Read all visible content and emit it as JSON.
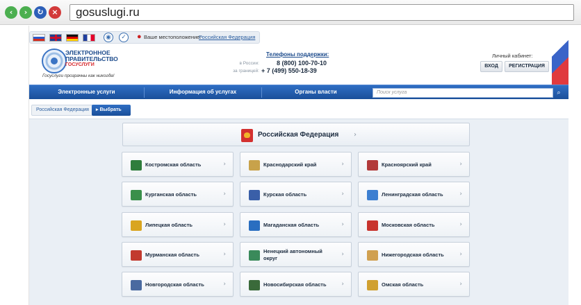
{
  "browser": {
    "url": "gosuslugi.ru",
    "buttons": [
      "back",
      "forward",
      "reload",
      "stop"
    ]
  },
  "topbar": {
    "languages": [
      "Русский",
      "English",
      "Deutsch",
      "Français"
    ],
    "location_label": "Ваше местоположение:",
    "location_value": "Российская Федерация"
  },
  "header": {
    "logo_line1": "ЭЛЕКТРОННОЕ",
    "logo_line2": "ПРАВИТЕЛЬСТВО",
    "logo_line3": "ГОСУСЛУГИ",
    "slogan": "Госуслуги прозрачны как никогда!",
    "support_title": "Телефоны поддержки:",
    "phone_ru_label": "в России:",
    "phone_ru": "8 (800) 100-70-10",
    "phone_abroad_label": "за границей:",
    "phone_abroad": "+ 7 (499) 550-18-39",
    "cabinet_title": "Личный кабинет:",
    "login": "ВХОД",
    "register": "РЕГИСТРАЦИЯ"
  },
  "navbar": {
    "items": [
      "Электронные услуги",
      "Информация об услугах",
      "Органы власти"
    ],
    "search_placeholder": "Поиск услуга"
  },
  "breadcrumb": {
    "current": "Российская Федерация",
    "select": "Выбрать"
  },
  "federation": {
    "name": "Российская Федерация"
  },
  "regions": [
    {
      "name": "Костромская область",
      "color": "#2f7d3c"
    },
    {
      "name": "Краснодарский край",
      "color": "#c8a24a"
    },
    {
      "name": "Красноярский край",
      "color": "#b23a3a"
    },
    {
      "name": "Курганская область",
      "color": "#3a8f4a"
    },
    {
      "name": "Курская область",
      "color": "#3a5fa8"
    },
    {
      "name": "Ленинградская область",
      "color": "#3d7fd1"
    },
    {
      "name": "Липецкая область",
      "color": "#d9a520"
    },
    {
      "name": "Магаданская область",
      "color": "#2a6ec0"
    },
    {
      "name": "Московская область",
      "color": "#c8342e"
    },
    {
      "name": "Мурманская область",
      "color": "#c23a2e"
    },
    {
      "name": "Ненецкий автономный округ",
      "color": "#3a8a5a"
    },
    {
      "name": "Нижегородская область",
      "color": "#d0a050"
    },
    {
      "name": "Новгородская область",
      "color": "#4a6aa0"
    },
    {
      "name": "Новосибирская область",
      "color": "#3a6a3a"
    },
    {
      "name": "Омская область",
      "color": "#d0a030"
    }
  ]
}
